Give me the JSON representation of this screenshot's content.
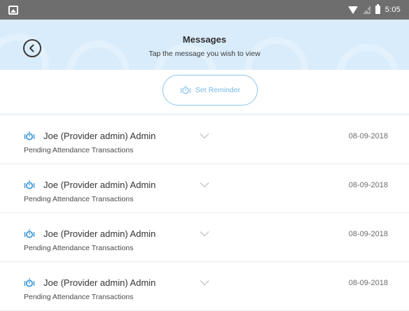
{
  "status_bar": {
    "time": "5:05",
    "icons": [
      "image-icon",
      "wifi-icon",
      "signal-icon",
      "battery-icon"
    ]
  },
  "header": {
    "title": "Messages",
    "subtitle": "Tap the message you wish to view",
    "back_icon": "back-arrow-icon"
  },
  "reminder": {
    "label": "Set Reminder",
    "icon": "alarm-icon"
  },
  "messages": [
    {
      "sender": "Joe (Provider admin) Admin",
      "date": "08-09-2018",
      "subject": "Pending Attendance Transactions"
    },
    {
      "sender": "Joe (Provider admin) Admin",
      "date": "08-09-2018",
      "subject": "Pending Attendance Transactions"
    },
    {
      "sender": "Joe (Provider admin) Admin",
      "date": "08-09-2018",
      "subject": "Pending Attendance Transactions"
    },
    {
      "sender": "Joe (Provider admin) Admin",
      "date": "08-09-2018",
      "subject": "Pending Attendance Transactions"
    }
  ],
  "colors": {
    "status_bar": "#6e6e6e",
    "header_bg": "#d9ecfb",
    "accent": "#74b9e6",
    "icon_blue": "#2f8fd8"
  }
}
